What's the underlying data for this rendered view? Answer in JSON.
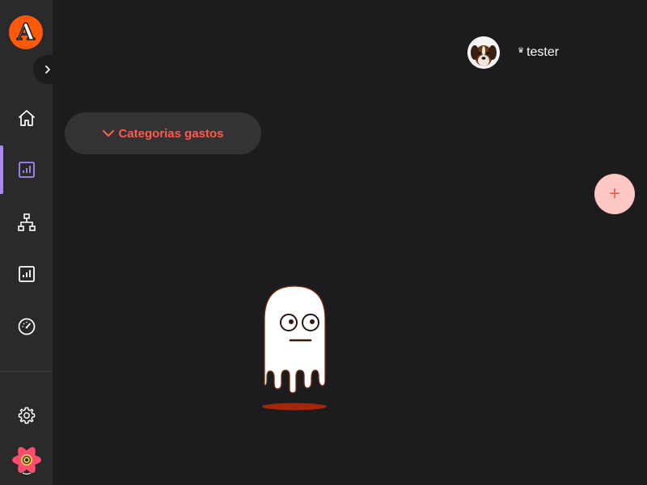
{
  "sidebar": {
    "logo_letter": "A",
    "nav": [
      {
        "name": "home",
        "icon": "home-icon",
        "active": false
      },
      {
        "name": "reports",
        "icon": "bar-chart-icon",
        "active": true
      },
      {
        "name": "hierarchy",
        "icon": "sitemap-icon",
        "active": false
      },
      {
        "name": "stats",
        "icon": "bar-chart-icon",
        "active": false
      },
      {
        "name": "dashboard",
        "icon": "gauge-icon",
        "active": false
      }
    ],
    "settings_icon": "gear-icon"
  },
  "header": {
    "username": "tester",
    "crown_icon": "♛"
  },
  "category": {
    "label": "Categorias gastos",
    "chevron": "chevron-down-icon"
  },
  "fab": {
    "label": "+"
  },
  "colors": {
    "background": "#1c1c1e",
    "sidebar": "#2a2a2c",
    "accent": "#ff5a4d",
    "active_indicator": "#a98bf0",
    "logo": "#ff5a0a"
  }
}
